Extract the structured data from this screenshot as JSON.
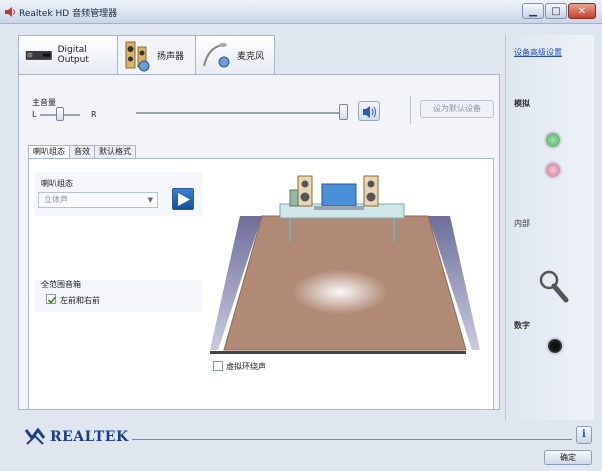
{
  "window": {
    "title": "Realtek HD 音频管理器"
  },
  "device_tabs": [
    {
      "label": "Digital Output",
      "icon": "digital-output-icon"
    },
    {
      "label": "扬声器",
      "icon": "speakers-icon"
    },
    {
      "label": "麦克风",
      "icon": "microphone-icon"
    }
  ],
  "volume": {
    "label": "主音量",
    "left": "L",
    "right": "R",
    "set_default_label": "设为默认设备"
  },
  "sub_tabs": [
    "喇叭组态",
    "音效",
    "默认格式"
  ],
  "speaker_config": {
    "label": "喇叭组态",
    "selected": "立体声"
  },
  "fullrange": {
    "label": "全范围音箱",
    "option": "左前和右前",
    "checked": true
  },
  "virtual_surround": {
    "label": "虚拟环绕声",
    "checked": false
  },
  "right_panel": {
    "link": "设备高级设置",
    "rear_label": "模拟",
    "front_label": "内部",
    "digital_label": "数字"
  },
  "footer": {
    "brand": "REALTEK",
    "ok_label": "确定"
  },
  "colors": {
    "accent_blue": "#1d3d87",
    "jack_green": "#6cc47a",
    "jack_pink": "#e596ad",
    "floor": "#b18a76"
  }
}
